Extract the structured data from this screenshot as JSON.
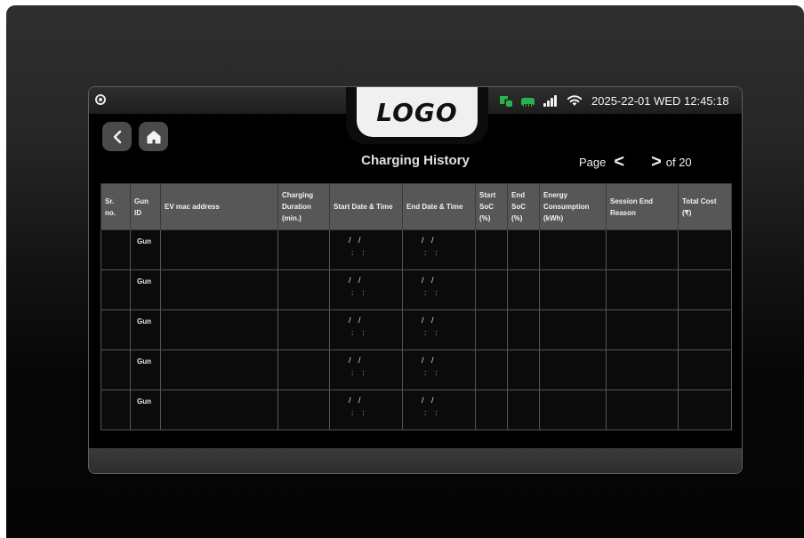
{
  "header": {
    "logo": "LOGO",
    "datetime": "2025-22-01 WED 12:45:18",
    "icons": [
      "power-icon",
      "plug-status-icon",
      "lan-icon",
      "signal-icon",
      "wifi-icon"
    ],
    "status_color": "#2bb24c"
  },
  "nav": {
    "back_icon": "chevron-left-icon",
    "home_icon": "home-icon"
  },
  "page": {
    "title": "Charging History"
  },
  "pager": {
    "label": "Page",
    "prev": "<",
    "next": ">",
    "total": "of 20"
  },
  "table": {
    "columns": [
      "Sr. no.",
      "Gun ID",
      "EV mac address",
      "Charging Duration (min.)",
      "Start Date & Time",
      "End Date & Time",
      "Start SoC (%)",
      "End SoC (%)",
      "Energy Consumption (kWh)",
      "Session End Reason",
      "Total Cost (₹)"
    ],
    "rows": [
      {
        "sr": "",
        "gun": "Gun",
        "mac": "",
        "duration": "",
        "start_date": "/ /",
        "start_time": ": :",
        "end_date": "/ /",
        "end_time": ": :",
        "start_soc": "",
        "end_soc": "",
        "energy": "",
        "reason": "",
        "cost": ""
      },
      {
        "sr": "",
        "gun": "Gun",
        "mac": "",
        "duration": "",
        "start_date": "/ /",
        "start_time": ": :",
        "end_date": "/ /",
        "end_time": ": :",
        "start_soc": "",
        "end_soc": "",
        "energy": "",
        "reason": "",
        "cost": ""
      },
      {
        "sr": "",
        "gun": "Gun",
        "mac": "",
        "duration": "",
        "start_date": "/ /",
        "start_time": ": :",
        "end_date": "/ /",
        "end_time": ": :",
        "start_soc": "",
        "end_soc": "",
        "energy": "",
        "reason": "",
        "cost": ""
      },
      {
        "sr": "",
        "gun": "Gun",
        "mac": "",
        "duration": "",
        "start_date": "/ /",
        "start_time": ": :",
        "end_date": "/ /",
        "end_time": ": :",
        "start_soc": "",
        "end_soc": "",
        "energy": "",
        "reason": "",
        "cost": ""
      },
      {
        "sr": "",
        "gun": "Gun",
        "mac": "",
        "duration": "",
        "start_date": "/ /",
        "start_time": ": :",
        "end_date": "/ /",
        "end_time": ": :",
        "start_soc": "",
        "end_soc": "",
        "energy": "",
        "reason": "",
        "cost": ""
      }
    ]
  }
}
